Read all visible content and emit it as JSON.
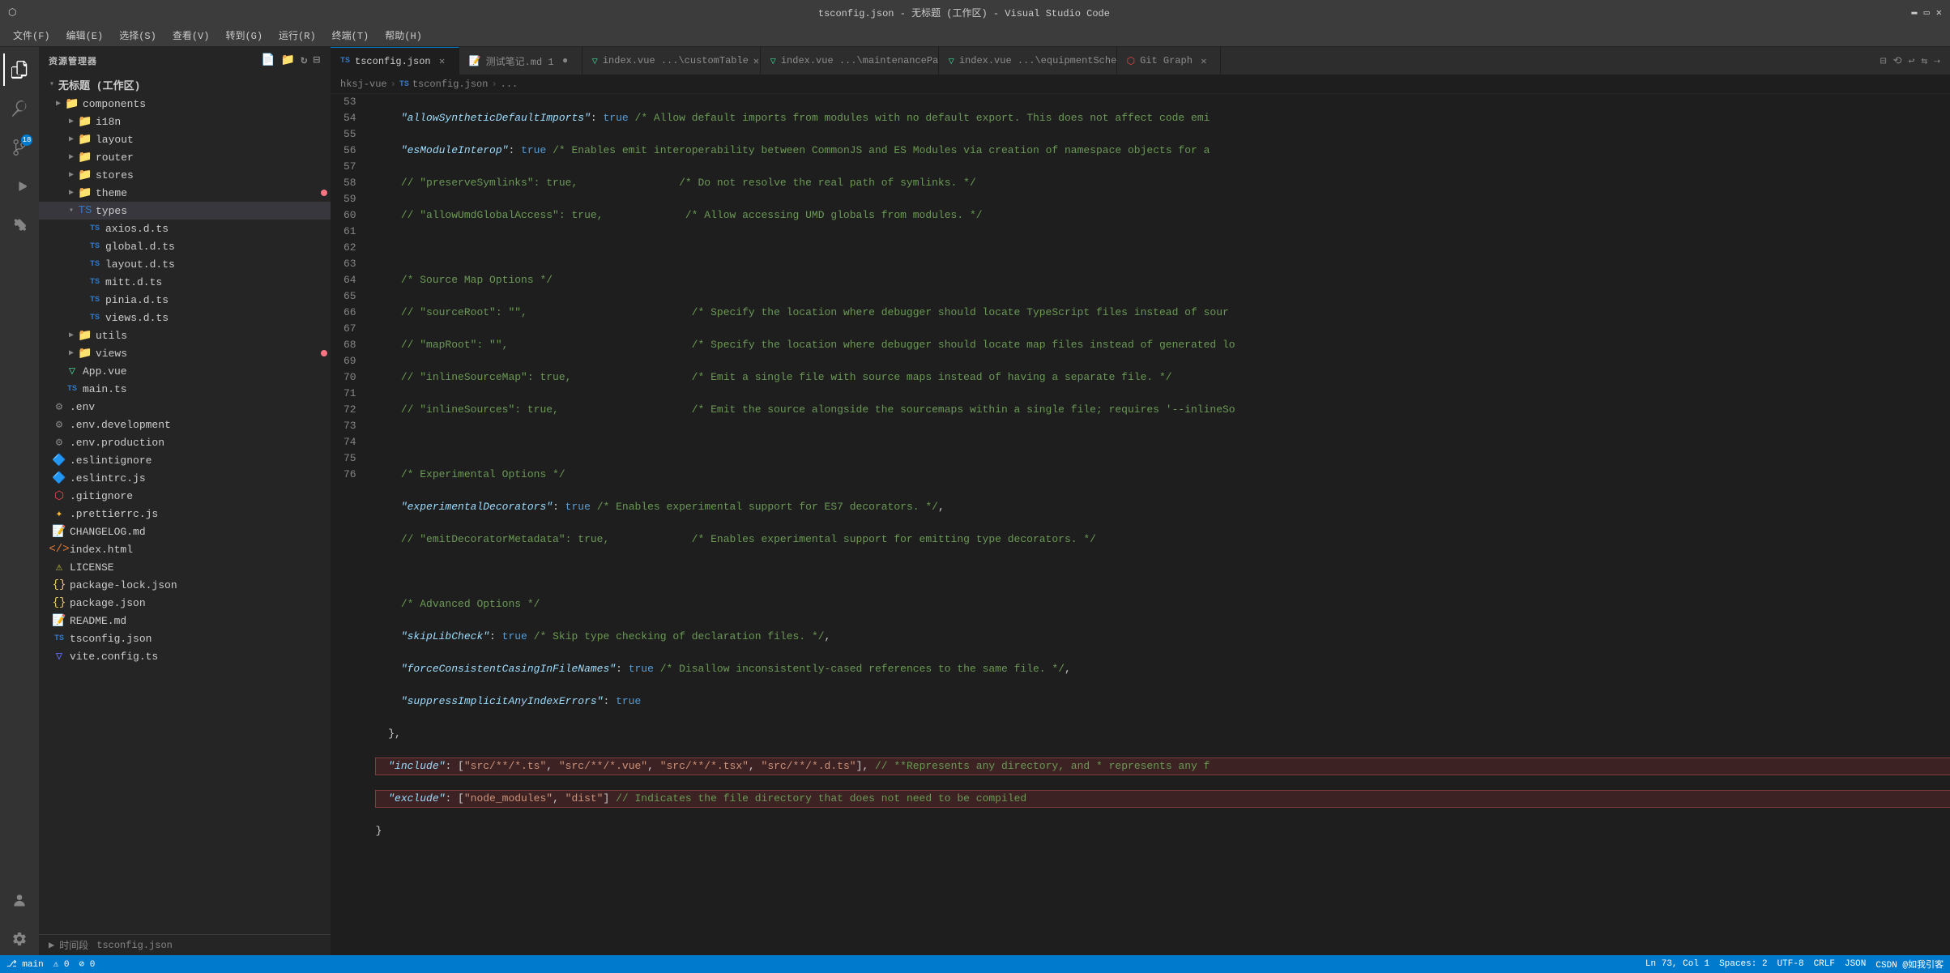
{
  "window": {
    "title": "tsconfig.json - 无标题 (工作区) - Visual Studio Code"
  },
  "menubar": {
    "items": [
      "文件(F)",
      "编辑(E)",
      "选择(S)",
      "查看(V)",
      "转到(G)",
      "运行(R)",
      "终端(T)",
      "帮助(H)"
    ]
  },
  "tabs": [
    {
      "label": "tsconfig.json",
      "icon": "ts",
      "active": true,
      "modified": false,
      "color": "#3178c6"
    },
    {
      "label": "测试笔记.md 1",
      "icon": "md",
      "active": false,
      "modified": true,
      "color": "#519aba"
    },
    {
      "label": "index.vue ...\\customTable",
      "icon": "vue",
      "active": false,
      "modified": false,
      "color": "#41b883"
    },
    {
      "label": "index.vue ...\\maintenanceParam",
      "icon": "vue",
      "active": false,
      "modified": false,
      "color": "#41b883"
    },
    {
      "label": "index.vue ...\\equipmentSchedule M",
      "icon": "vue",
      "active": false,
      "modified": true,
      "color": "#41b883"
    },
    {
      "label": "Git Graph",
      "icon": "git-graph",
      "active": false,
      "modified": false,
      "color": "#f44747"
    }
  ],
  "breadcrumb": {
    "parts": [
      "hksj-vue",
      "tsconfig.json",
      "..."
    ]
  },
  "sidebar": {
    "title": "资源管理器",
    "workspace": "无标题 (工作区)",
    "tree": [
      {
        "level": 0,
        "type": "folder",
        "name": "components",
        "expanded": false,
        "icon": "folder"
      },
      {
        "level": 1,
        "type": "folder",
        "name": "i18n",
        "expanded": false,
        "icon": "folder"
      },
      {
        "level": 1,
        "type": "folder",
        "name": "layout",
        "expanded": false,
        "icon": "folder"
      },
      {
        "level": 1,
        "type": "folder",
        "name": "router",
        "expanded": false,
        "icon": "folder"
      },
      {
        "level": 1,
        "type": "folder",
        "name": "stores",
        "expanded": false,
        "icon": "folder"
      },
      {
        "level": 1,
        "type": "folder",
        "name": "theme",
        "expanded": false,
        "icon": "folder",
        "dot": true
      },
      {
        "level": 1,
        "type": "folder",
        "name": "types",
        "expanded": true,
        "icon": "folder",
        "selected": true
      },
      {
        "level": 2,
        "type": "file",
        "name": "axios.d.ts",
        "icon": "ts"
      },
      {
        "level": 2,
        "type": "file",
        "name": "global.d.ts",
        "icon": "ts"
      },
      {
        "level": 2,
        "type": "file",
        "name": "layout.d.ts",
        "icon": "ts"
      },
      {
        "level": 2,
        "type": "file",
        "name": "mitt.d.ts",
        "icon": "ts"
      },
      {
        "level": 2,
        "type": "file",
        "name": "pinia.d.ts",
        "icon": "ts"
      },
      {
        "level": 2,
        "type": "file",
        "name": "views.d.ts",
        "icon": "ts"
      },
      {
        "level": 1,
        "type": "folder",
        "name": "utils",
        "expanded": false,
        "icon": "folder"
      },
      {
        "level": 1,
        "type": "folder",
        "name": "views",
        "expanded": false,
        "icon": "folder",
        "dot": true
      },
      {
        "level": 1,
        "type": "file",
        "name": "App.vue",
        "icon": "vue"
      },
      {
        "level": 1,
        "type": "file",
        "name": "main.ts",
        "icon": "ts"
      },
      {
        "level": 0,
        "type": "file",
        "name": ".env",
        "icon": "env"
      },
      {
        "level": 0,
        "type": "file",
        "name": ".env.development",
        "icon": "env"
      },
      {
        "level": 0,
        "type": "file",
        "name": ".env.production",
        "icon": "env"
      },
      {
        "level": 0,
        "type": "file",
        "name": ".eslintignore",
        "icon": "eslint"
      },
      {
        "level": 0,
        "type": "file",
        "name": ".eslintrc.js",
        "icon": "eslint",
        "arrow": true
      },
      {
        "level": 0,
        "type": "file",
        "name": ".gitignore",
        "icon": "git"
      },
      {
        "level": 0,
        "type": "file",
        "name": ".prettierrc.js",
        "icon": "prettier"
      },
      {
        "level": 0,
        "type": "file",
        "name": "CHANGELOG.md",
        "icon": "md"
      },
      {
        "level": 0,
        "type": "file",
        "name": "index.html",
        "icon": "html"
      },
      {
        "level": 0,
        "type": "file",
        "name": "LICENSE",
        "icon": "license"
      },
      {
        "level": 0,
        "type": "file",
        "name": "package-lock.json",
        "icon": "json"
      },
      {
        "level": 0,
        "type": "file",
        "name": "package.json",
        "icon": "json"
      },
      {
        "level": 0,
        "type": "file",
        "name": "README.md",
        "icon": "md"
      },
      {
        "level": 0,
        "type": "file",
        "name": "tsconfig.json",
        "icon": "ts"
      },
      {
        "level": 0,
        "type": "file",
        "name": "vite.config.ts",
        "icon": "vite"
      }
    ]
  },
  "editor": {
    "lines": [
      {
        "num": 53,
        "content": "    \"allowSyntheticDefaultImports\": true /* Allow default imports from modules with no default export. This does not affect code emi",
        "highlighted": false
      },
      {
        "num": 54,
        "content": "    \"esModuleInterop\": true /* Enables emit interoperability between CommonJS and ES Modules via creation of namespace objects for a",
        "highlighted": false
      },
      {
        "num": 55,
        "content": "    // \"preserveSymlinks\": true,                /* Do not resolve the real path of symlinks. */",
        "highlighted": false
      },
      {
        "num": 56,
        "content": "    // \"allowUmdGlobalAccess\": true,             /* Allow accessing UMD globals from modules. */",
        "highlighted": false
      },
      {
        "num": 57,
        "content": "",
        "highlighted": false
      },
      {
        "num": 58,
        "content": "    /* Source Map Options */",
        "highlighted": false
      },
      {
        "num": 59,
        "content": "    // \"sourceRoot\": \"\",                          /* Specify the location where debugger should locate TypeScript files instead of sour",
        "highlighted": false
      },
      {
        "num": 60,
        "content": "    // \"mapRoot\": \"\",                             /* Specify the location where debugger should locate map files instead of generated lo",
        "highlighted": false
      },
      {
        "num": 61,
        "content": "    // \"inlineSourceMap\": true,                   /* Emit a single file with source maps instead of having a separate file. */",
        "highlighted": false
      },
      {
        "num": 62,
        "content": "    // \"inlineSources\": true,                     /* Emit the source alongside the sourcemaps within a single file; requires '--inlineSo",
        "highlighted": false
      },
      {
        "num": 63,
        "content": "",
        "highlighted": false
      },
      {
        "num": 64,
        "content": "    /* Experimental Options */",
        "highlighted": false
      },
      {
        "num": 65,
        "content": "    \"experimentalDecorators\": true /* Enables experimental support for ES7 decorators. */,",
        "highlighted": false
      },
      {
        "num": 66,
        "content": "    // \"emitDecoratorMetadata\": true,             /* Enables experimental support for emitting type decorators. */",
        "highlighted": false
      },
      {
        "num": 67,
        "content": "",
        "highlighted": false
      },
      {
        "num": 68,
        "content": "    /* Advanced Options */",
        "highlighted": false
      },
      {
        "num": 69,
        "content": "    \"skipLibCheck\": true /* Skip type checking of declaration files. */,",
        "highlighted": false
      },
      {
        "num": 70,
        "content": "    \"forceConsistentCasingInFileNames\": true /* Disallow inconsistently-cased references to the same file. */,",
        "highlighted": false
      },
      {
        "num": 71,
        "content": "    \"suppressImplicitAnyIndexErrors\": true",
        "highlighted": false
      },
      {
        "num": 72,
        "content": "  },",
        "highlighted": false
      },
      {
        "num": 73,
        "content": "  \"include\": [\"src/**/*.ts\", \"src/**/*.vue\", \"src/**/*.tsx\", \"src/**/*.d.ts\"], // **Represents any directory, and * represents any f",
        "highlighted": true
      },
      {
        "num": 74,
        "content": "  \"exclude\": [\"node_modules\", \"dist\"] // Indicates the file directory that does not need to be compiled",
        "highlighted": true
      },
      {
        "num": 75,
        "content": "}",
        "highlighted": false
      },
      {
        "num": 76,
        "content": "",
        "highlighted": false
      }
    ]
  },
  "statusbar": {
    "left": [
      "⎇ main",
      "⚠ 0",
      "⊘ 0"
    ],
    "right": [
      "Ln 73, Col 1",
      "Spaces: 2",
      "UTF-8",
      "CRLF",
      "JSON",
      "CSDN @如我引客"
    ],
    "time_label": "时间段",
    "time_value": "tsconfig.json"
  }
}
